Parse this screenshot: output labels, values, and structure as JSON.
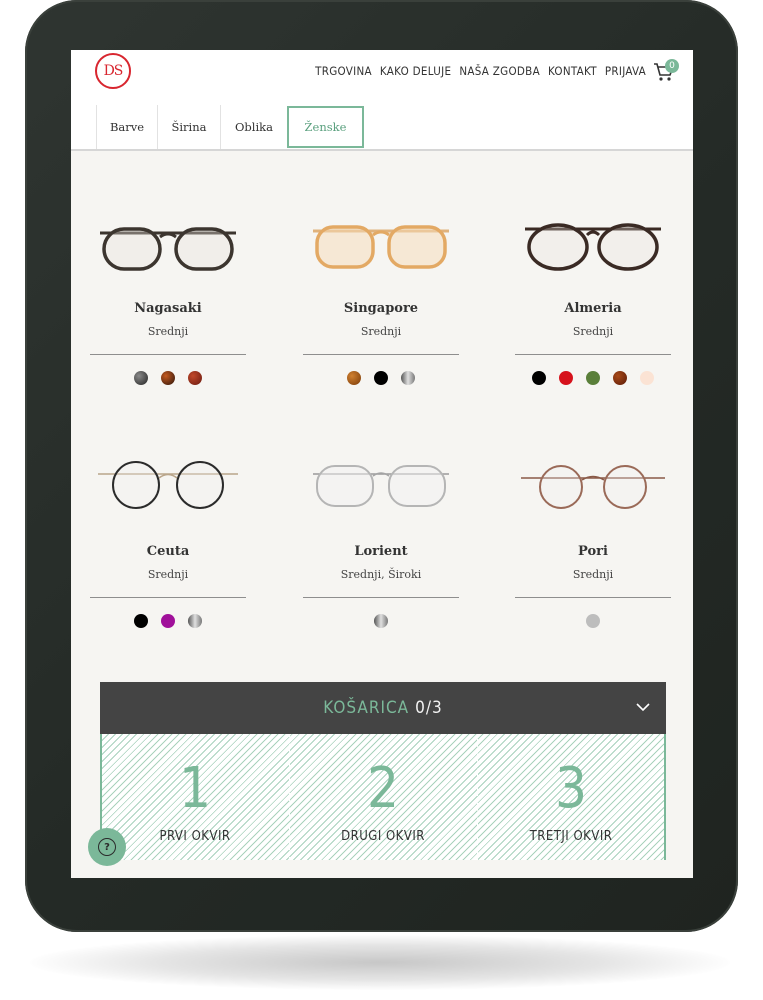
{
  "header": {
    "logo": "DS",
    "nav": [
      "TRGOVINA",
      "KAKO DELUJE",
      "NAŠA ZGODBA",
      "KONTAKT",
      "PRIJAVA"
    ],
    "cart_count": "0"
  },
  "filters": [
    "Barve",
    "Širina",
    "Oblika",
    "Ženske"
  ],
  "products": [
    {
      "name": "Nagasaki",
      "size": "Srednji",
      "swatches": [
        "#3a3a3a",
        "#5a2a12",
        "#8a2a18"
      ]
    },
    {
      "name": "Singapore",
      "size": "Srednji",
      "swatches": [
        "#9a4a12",
        "#000000",
        "#8a8a8a"
      ]
    },
    {
      "name": "Almeria",
      "size": "Srednji",
      "swatches": [
        "#000000",
        "#d6121c",
        "#5a7f3a",
        "#7a2a10",
        "#fbe3d4"
      ]
    },
    {
      "name": "Ceuta",
      "size": "Srednji",
      "swatches": [
        "#000000",
        "#a0109a",
        "#9a9a9a"
      ]
    },
    {
      "name": "Lorient",
      "size": "Srednji, Široki",
      "swatches": [
        "#8a8a8a"
      ]
    },
    {
      "name": "Pori",
      "size": "Srednji",
      "swatches": [
        "#bdbdbd"
      ]
    }
  ],
  "cart": {
    "title": "KOŠARICA",
    "count": "0/3",
    "slots": [
      {
        "num": "1",
        "label": "PRVI OKVIR"
      },
      {
        "num": "2",
        "label": "DRUGI OKVIR"
      },
      {
        "num": "3",
        "label": "TRETJI OKVIR"
      }
    ]
  }
}
